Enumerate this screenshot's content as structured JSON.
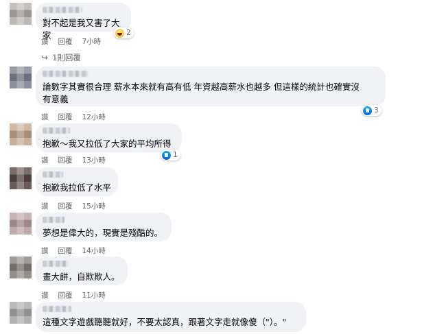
{
  "comments": [
    {
      "text": "對不起是我又害了大家",
      "actions": {
        "like": "讚",
        "reply": "回覆",
        "time": "7小時"
      },
      "reaction": {
        "type": "haha-icon",
        "count": "2"
      },
      "replies_label": "1則回覆"
    },
    {
      "text": "論數字其實很合理 薪水本來就有高有低 年資越高薪水也越多 但這樣的統計也確實沒\n有意義",
      "actions": {
        "like": "讚",
        "reply": "回覆",
        "time": "12小時"
      },
      "reaction": {
        "type": "like-icon",
        "count": "3"
      }
    },
    {
      "text": "抱歉～我又拉低了大家的平均所得",
      "actions": {
        "like": "讚",
        "reply": "回覆",
        "time": "13小時"
      },
      "reaction": {
        "type": "like-icon",
        "count": "1"
      }
    },
    {
      "text": "抱歉我拉低了水平",
      "actions": {
        "like": "讚",
        "reply": "回覆",
        "time": "15小時"
      }
    },
    {
      "text": "夢想是偉大的，現實是殘酷的。",
      "actions": {
        "like": "讚",
        "reply": "回覆",
        "time": "14小時"
      }
    },
    {
      "text": "畫大餅，自欺欺人。",
      "actions": {
        "like": "讚",
        "reply": "回覆",
        "time": "11小時"
      }
    },
    {
      "text": "這種文字遊戲聽聽就好，不要太認真，跟著文字走就像傻（\"）。\""
    }
  ],
  "colors": {
    "bubble": "#f0f2f5",
    "meta": "#65676b",
    "like": "#1877f2"
  }
}
